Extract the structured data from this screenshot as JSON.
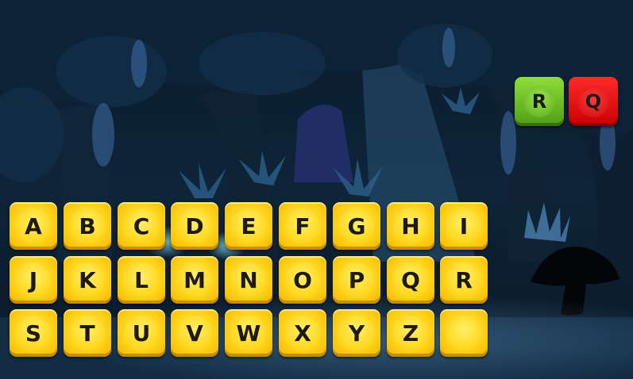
{
  "controls": {
    "restart_label": "R",
    "quit_label": "Q",
    "restart_color": "#6fc21f",
    "quit_color": "#e00000"
  },
  "keyboard": {
    "rows": [
      [
        "A",
        "B",
        "C",
        "D",
        "E",
        "F",
        "G",
        "H",
        "I"
      ],
      [
        "J",
        "K",
        "L",
        "M",
        "N",
        "O",
        "P",
        "Q",
        "R"
      ],
      [
        "S",
        "T",
        "U",
        "V",
        "W",
        "X",
        "Y",
        "Z",
        ""
      ]
    ],
    "key_color": "#ffd21a"
  },
  "background": {
    "sky_color": "#1a2a55",
    "foliage_color": "#0c2238"
  }
}
